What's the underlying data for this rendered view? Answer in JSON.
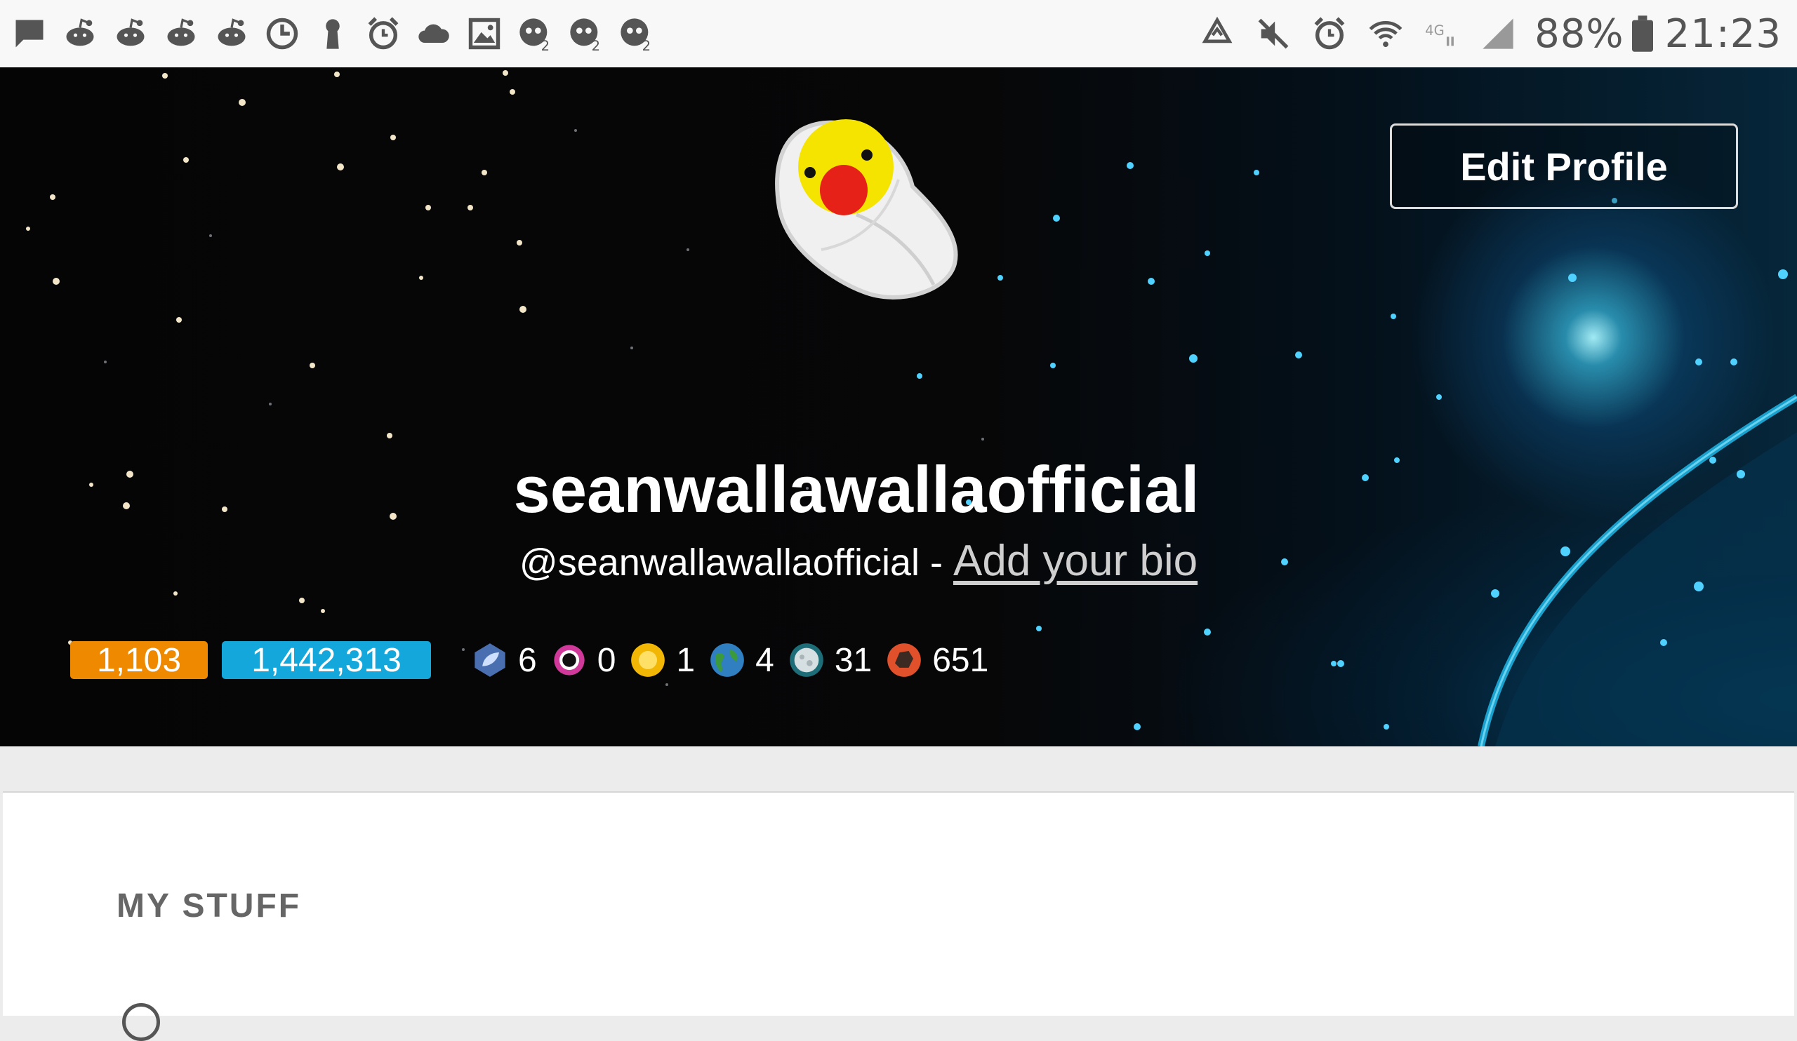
{
  "status_bar": {
    "left_icons": [
      "message-icon",
      "reddit-icon",
      "reddit-icon",
      "reddit-icon",
      "reddit-icon",
      "clock-icon",
      "keyhole-icon",
      "alarm-icon",
      "cloud-icon",
      "image-icon",
      "robot-notification-icon",
      "robot-notification-icon",
      "robot-notification-icon"
    ],
    "right_icons": [
      "recycle-icon",
      "mute-icon",
      "alarm-icon",
      "wifi-icon",
      "4g-icon",
      "signal-icon"
    ],
    "battery": "88%",
    "time": "21:23"
  },
  "profile": {
    "display_name": "seanwallawallaofficial",
    "handle": "@seanwallawallaofficial",
    "separator": " - ",
    "bio_placeholder": "Add your bio",
    "edit_button": "Edit Profile",
    "karma_badge": "1,103",
    "credits_badge": "1,442,313",
    "stats": [
      {
        "icon": "leaf-badge-icon",
        "value": "6",
        "color": "#4a6fb0"
      },
      {
        "icon": "ring-badge-icon",
        "value": "0",
        "color": "#d0399a"
      },
      {
        "icon": "sun-badge-icon",
        "value": "1",
        "color": "#f2b705"
      },
      {
        "icon": "earth-badge-icon",
        "value": "4",
        "color": "#3b9a3b"
      },
      {
        "icon": "moon-badge-icon",
        "value": "31",
        "color": "#7fb9c2"
      },
      {
        "icon": "rock-badge-icon",
        "value": "651",
        "color": "#e0502a"
      }
    ]
  },
  "content": {
    "section_title": "MY STUFF"
  },
  "colors": {
    "karma": "#ef8a00",
    "credits": "#13a7dc",
    "status_icon": "#555555"
  }
}
